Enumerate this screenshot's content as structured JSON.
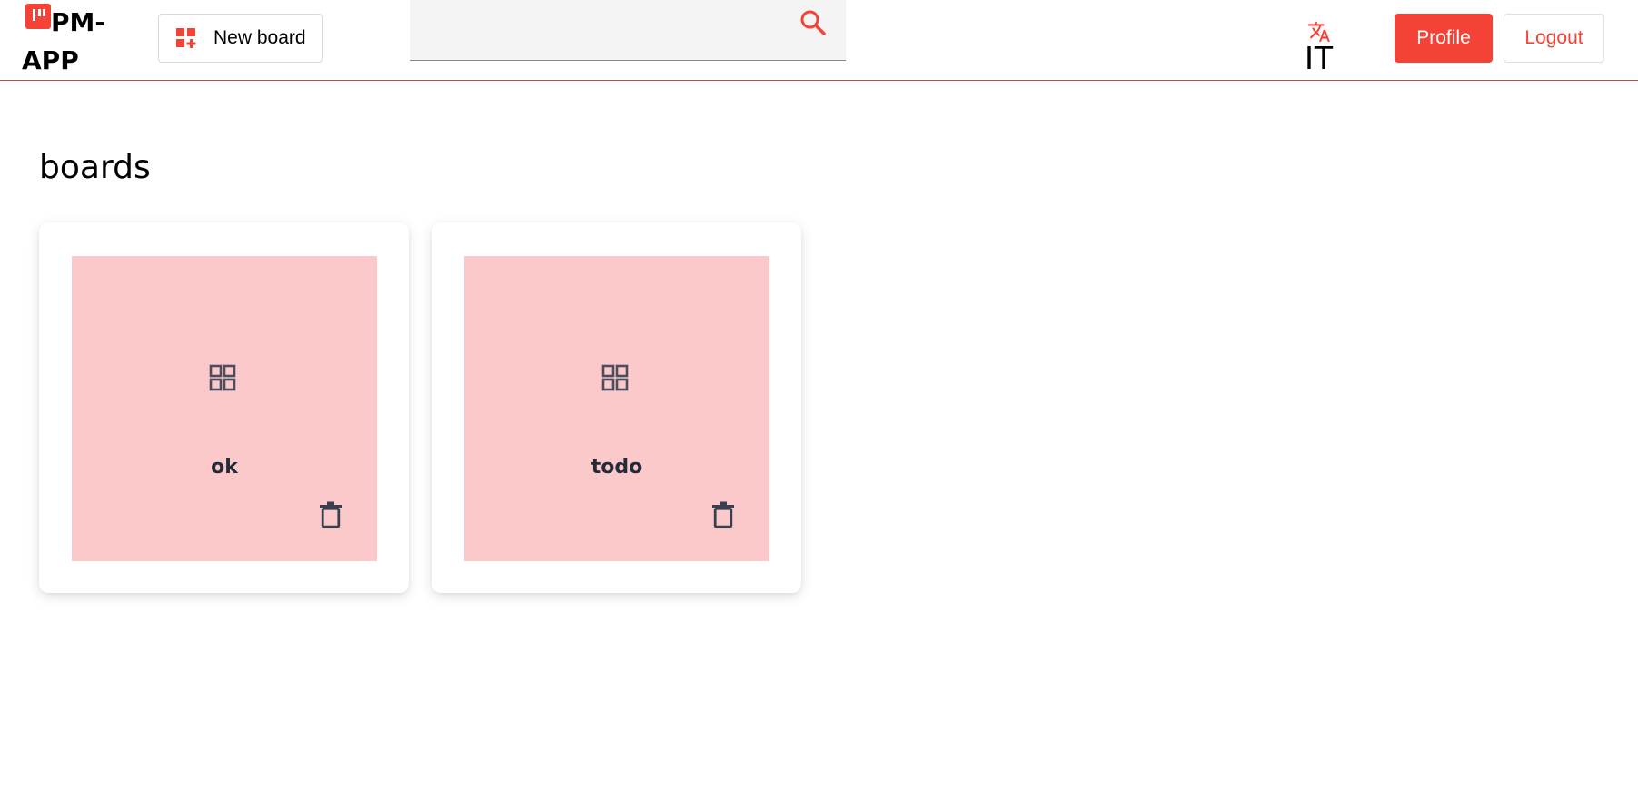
{
  "app": {
    "brand_line1": "PM-",
    "brand_line2": "APP",
    "accent_color": "#f44336"
  },
  "header": {
    "new_board_label": "New board",
    "new_board_icon": "add-board-icon",
    "search": {
      "value": "",
      "placeholder": "",
      "icon": "search-icon"
    },
    "language": {
      "icon": "translate-icon",
      "label": "IT"
    },
    "profile_label": "Profile",
    "logout_label": "Logout"
  },
  "main": {
    "heading": "boards",
    "boards": [
      {
        "name": "ok",
        "icon": "dashboard-icon",
        "delete_icon": "trash-icon",
        "tile_color": "#fcc9ca"
      },
      {
        "name": "todo",
        "icon": "dashboard-icon",
        "delete_icon": "trash-icon",
        "tile_color": "#fcc9ca"
      }
    ]
  }
}
